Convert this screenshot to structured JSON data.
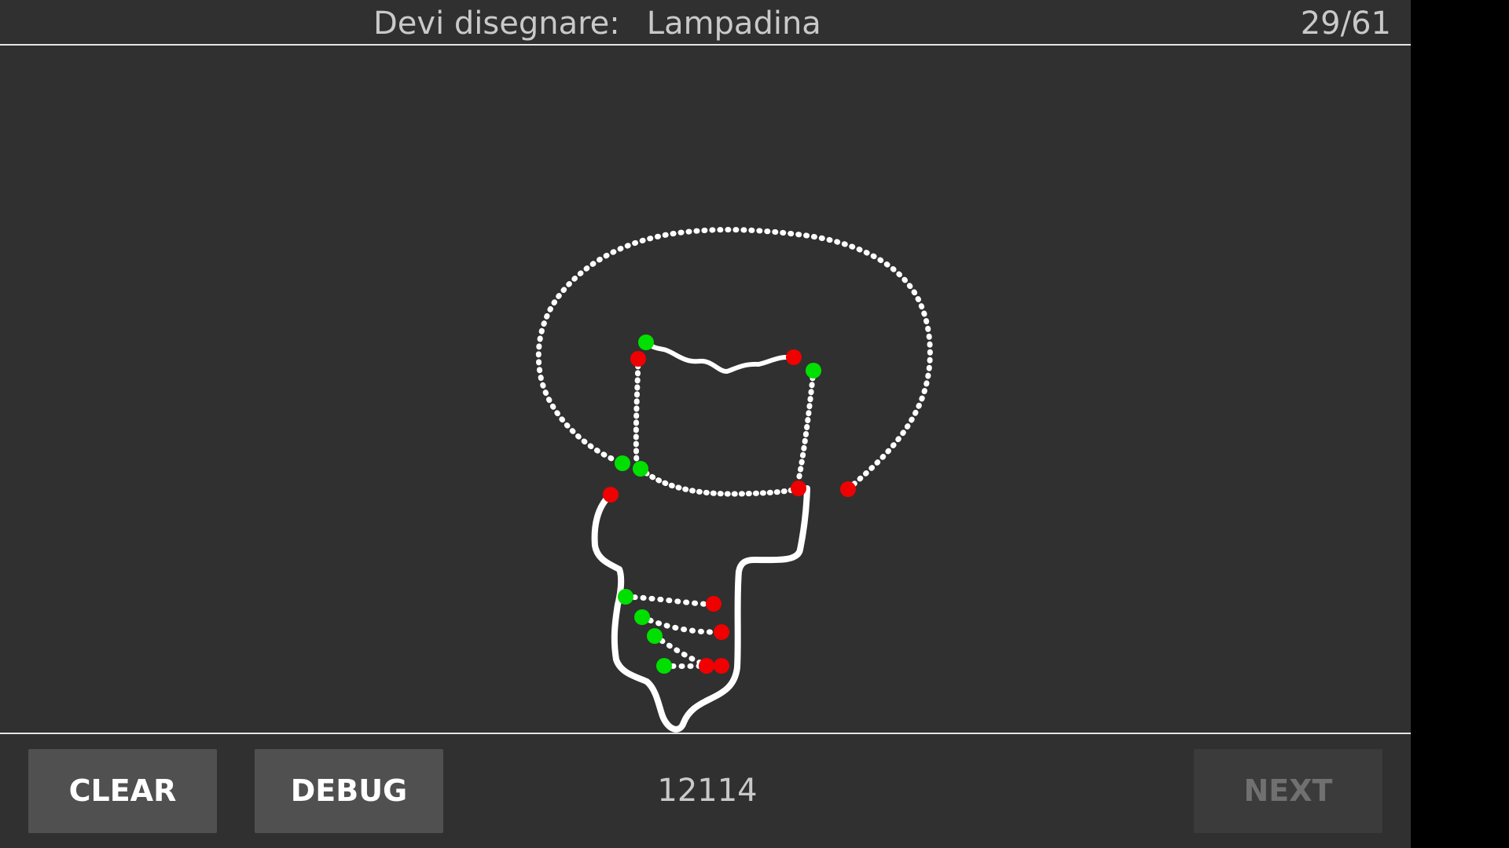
{
  "header": {
    "prompt_label": "Devi disegnare:",
    "target_word": "Lampadina",
    "progress": "29/61"
  },
  "toolbar": {
    "clear_label": "CLEAR",
    "debug_label": "DEBUG",
    "score": "12114",
    "next_label": "NEXT"
  },
  "drawing": {
    "stroke_color": "#ffffff",
    "start_marker_color": "#00e000",
    "end_marker_color": "#f00000",
    "stroke_count": 12
  },
  "colors": {
    "background": "#303030",
    "button": "#505050",
    "button_disabled": "#3b3b3b",
    "text": "#c9c9c9"
  }
}
